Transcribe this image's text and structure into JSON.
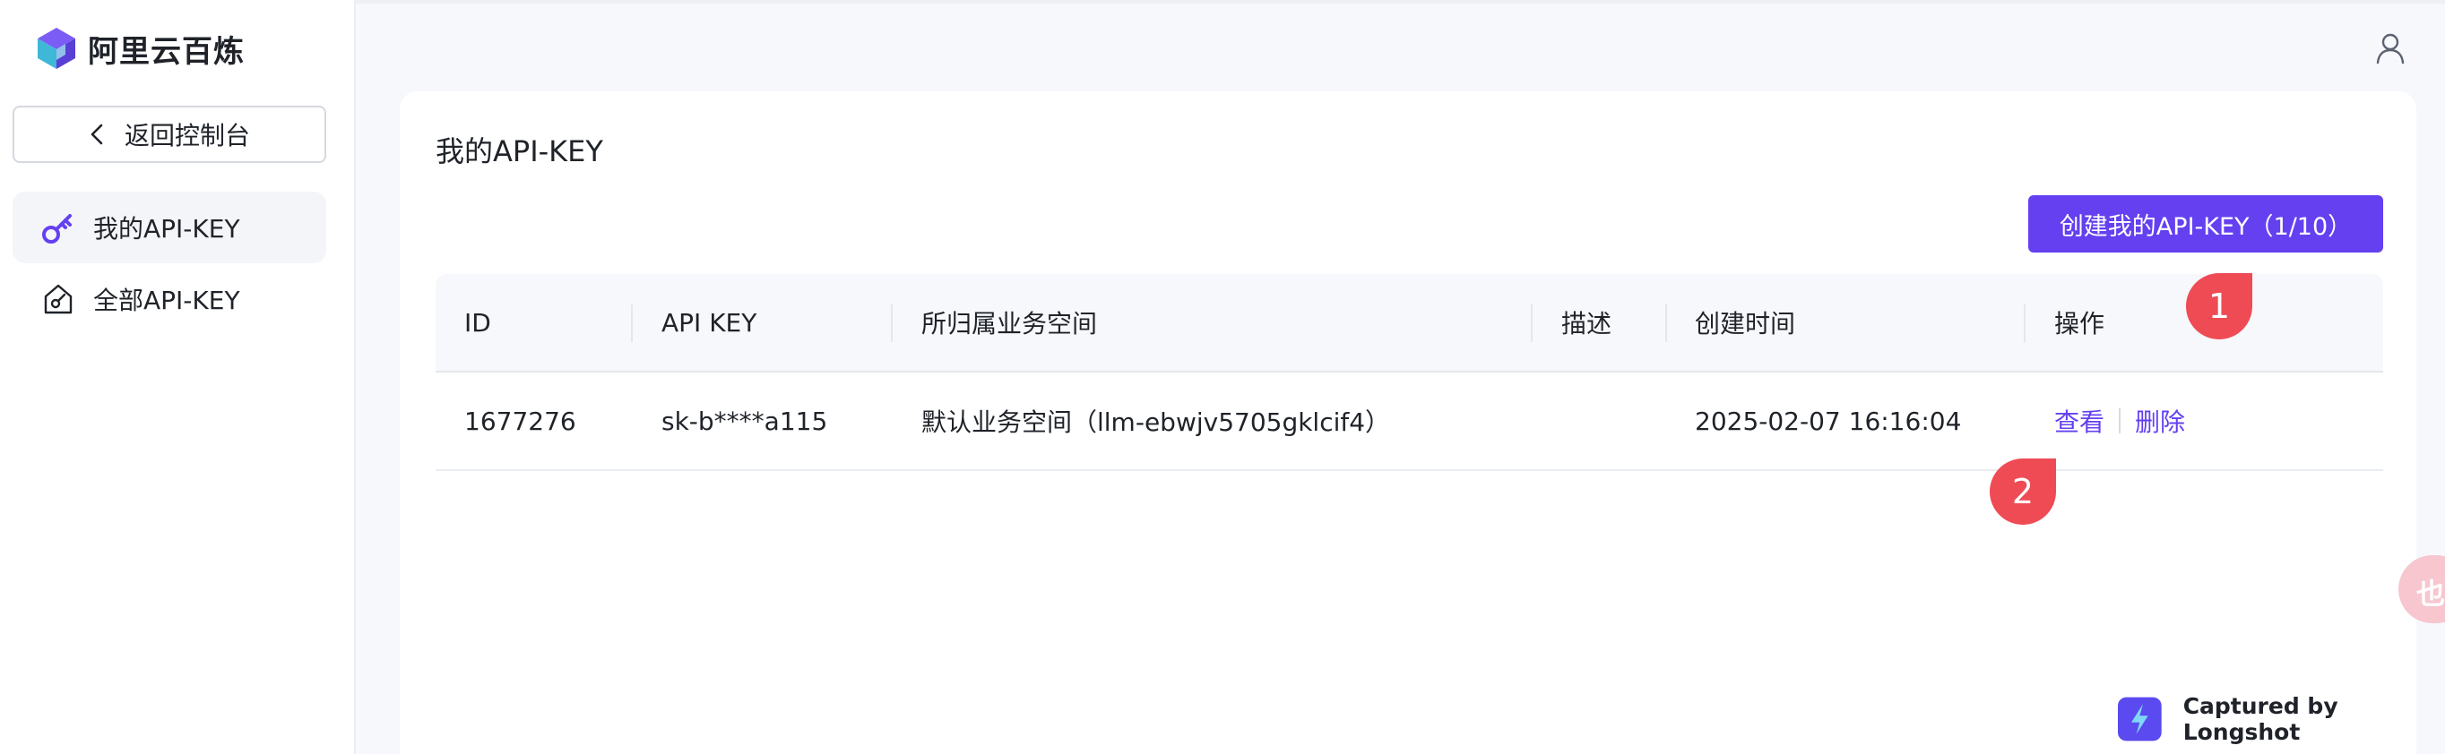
{
  "app": {
    "name": "阿里云百炼"
  },
  "sidebar": {
    "back_label": "返回控制台",
    "items": [
      {
        "label": "我的API-KEY",
        "icon": "key-icon",
        "active": true
      },
      {
        "label": "全部API-KEY",
        "icon": "house-key-icon",
        "active": false
      }
    ]
  },
  "main": {
    "title": "我的API-KEY",
    "create_button": "创建我的API-KEY（1/10）",
    "table": {
      "headers": [
        "ID",
        "API KEY",
        "所归属业务空间",
        "描述",
        "创建时间",
        "操作"
      ],
      "rows": [
        {
          "id": "1677276",
          "api_key": "sk-b****a115",
          "workspace": "默认业务空间（llm-ebwjv5705gklcif4）",
          "description": "",
          "created": "2025-02-07 16:16:04",
          "actions": [
            "查看",
            "删除"
          ]
        }
      ]
    }
  },
  "annotations": [
    "1",
    "2"
  ],
  "float_bubble": {
    "text": "也A"
  },
  "watermark": "Captured by Longshot",
  "colors": {
    "accent": "#6440f0",
    "marker": "#ef4b55",
    "sidebar_active": "#f4f5f9",
    "background": "#f7f8fc"
  }
}
